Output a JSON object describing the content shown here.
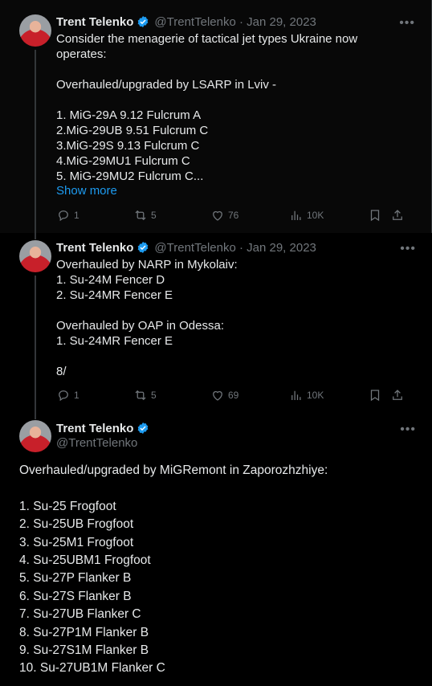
{
  "tweets": [
    {
      "author_name": "Trent Telenko",
      "author_handle": "@TrentTelenko · Jan 29, 2023",
      "body": "Consider the menagerie of tactical jet types Ukraine now operates:\n\nOverhauled/upgraded by LSARP in Lviv -\n\n1. MiG-29A 9.12 Fulcrum A\n2.MiG-29UB 9.51 Fulcrum C\n3.MiG-29S 9.13 Fulcrum C\n4.MiG-29MU1 Fulcrum C\n5. MiG-29MU2 Fulcrum C...",
      "show_more": "Show more",
      "replies": "1",
      "retweets": "5",
      "likes": "76",
      "views": "10K"
    },
    {
      "author_name": "Trent Telenko",
      "author_handle": "@TrentTelenko · Jan 29, 2023",
      "body": "Overhauled by NARP in Mykolaiv:\n1. Su-24M Fencer D\n2. Su-24MR Fencer E\n\nOverhauled by OAP in Odessa:\n1. Su-24MR Fencer E\n\n8/",
      "replies": "1",
      "retweets": "5",
      "likes": "69",
      "views": "10K"
    },
    {
      "author_name": "Trent Telenko",
      "author_handle": "@TrentTelenko",
      "body": "Overhauled/upgraded by MiGRemont in Zaporozhzhiye:\n\n1. Su-25 Frogfoot\n2. Su-25UB Frogfoot\n3. Su-25M1 Frogfoot\n4. Su-25UBM1 Frogfoot\n5. Su-27P Flanker B\n6. Su-27S Flanker B\n7. Su-27UB Flanker C\n8. Su-27P1M Flanker B\n9. Su-27S1M Flanker B\n10. Su-27UB1M Flanker C"
    }
  ],
  "icons": {
    "verified": "verified-badge-icon",
    "more": "more-icon",
    "reply": "reply-icon",
    "retweet": "retweet-icon",
    "like": "like-icon",
    "views": "views-icon",
    "bookmark": "bookmark-icon",
    "share": "share-icon"
  },
  "colors": {
    "background": "#000000",
    "text": "#e7e9ea",
    "secondary": "#71767b",
    "link": "#1d9bf0",
    "verified": "#1d9bf0"
  }
}
